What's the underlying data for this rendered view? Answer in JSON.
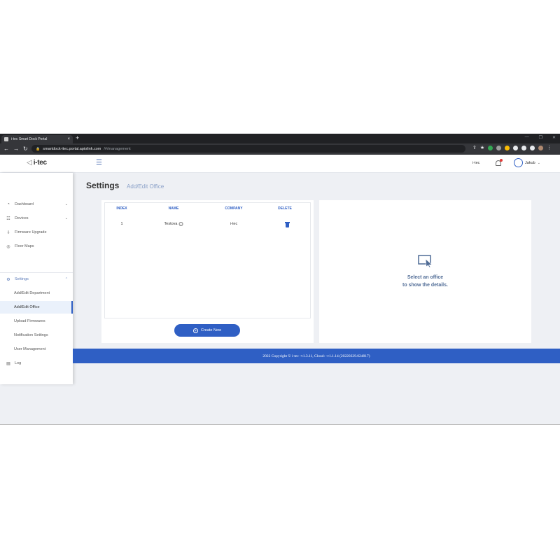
{
  "browser": {
    "tab_title": "i-tec Smart Dock Portal",
    "tab_close": "×",
    "new_tab": "+",
    "url_host": "smartdock-itec.portal.apiolink.com",
    "url_path": "/#/management"
  },
  "header": {
    "logo_text": "i-tec",
    "org_name": "i-tec",
    "user_name": "Jakub"
  },
  "sidebar": {
    "dashboard": "Dashboard",
    "devices": "Devices",
    "firmware_upgrade": "Firmware Upgrade",
    "floor_maps": "Floor Maps",
    "settings": "Settings",
    "sub": {
      "add_edit_department": "Add/Edit Department",
      "add_edit_office": "Add/Edit Office",
      "upload_firmwares": "Upload Firmwares",
      "notification_settings": "Notification Settings",
      "user_management": "User Management"
    },
    "log": "Log"
  },
  "page": {
    "title": "Settings",
    "subtitle": "Add/Edit Office"
  },
  "table": {
    "headers": {
      "index": "INDEX",
      "name": "NAME",
      "company": "COMPANY",
      "delete": "DELETE"
    },
    "rows": [
      {
        "index": "1",
        "name": "Testova",
        "company": "i-tec"
      }
    ]
  },
  "create_button": "Create New",
  "details": {
    "line1": "Select an office",
    "line2": "to show the details."
  },
  "footer": "2022 Copyright © i-tec -v1.3.11, Cloud: -v1.1.14 (20220329.024817)",
  "colors": {
    "primary": "#2f5fc4",
    "background": "#eef0f4"
  }
}
